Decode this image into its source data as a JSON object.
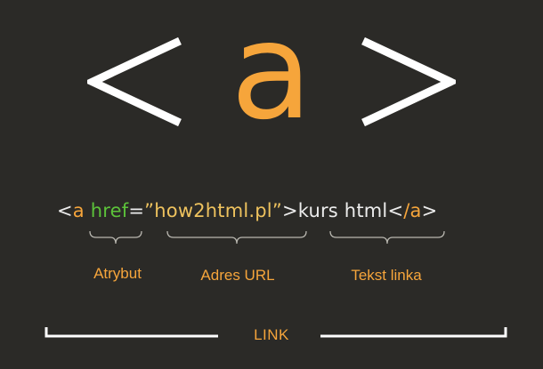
{
  "symbol": {
    "open_bracket": "<",
    "tag_letter": "a",
    "close_bracket": ">"
  },
  "code": {
    "lt": "<",
    "tag": "a",
    "space": " ",
    "attr": "href",
    "eq": "=",
    "quote_open": "”",
    "url": "how2html.pl",
    "quote_close": "”",
    "gt": ">",
    "text": "kurs html",
    "close_lt": "<",
    "close_tag": "/a",
    "close_gt": ">"
  },
  "annotations": {
    "attribute": "Atrybut",
    "url": "Adres URL",
    "link_text": "Tekst linka"
  },
  "link_label": "LINK",
  "colors": {
    "background": "#2b2a27",
    "orange": "#f6a53b",
    "green": "#5cc23a",
    "yellow": "#eec25e",
    "white": "#ececec"
  }
}
